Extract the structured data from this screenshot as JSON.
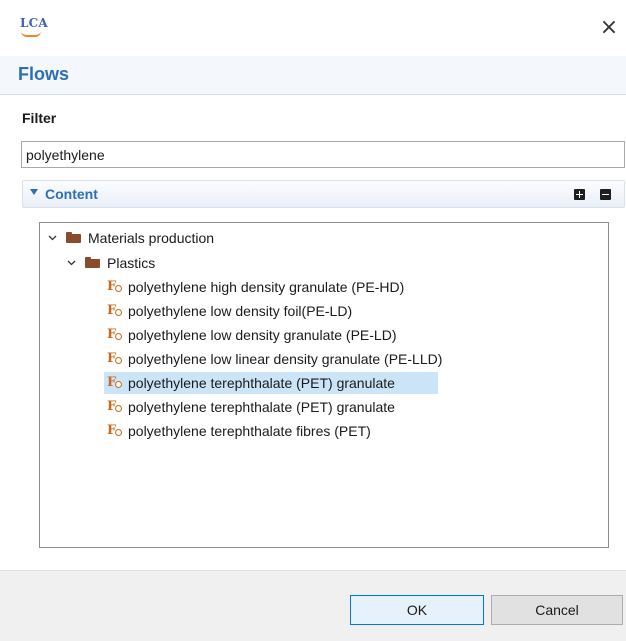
{
  "window": {
    "logo_text": "LCA",
    "close_glyph": "×"
  },
  "dialog": {
    "title": "Flows"
  },
  "filter": {
    "label": "Filter",
    "value": "polyethylene"
  },
  "section": {
    "title": "Content",
    "expand_icon": "plus-square-icon",
    "collapse_icon": "minus-square-icon"
  },
  "tree": {
    "root": {
      "label": "Materials production",
      "expanded": true
    },
    "category": {
      "label": "Plastics",
      "expanded": true
    },
    "flows": [
      {
        "label": "polyethylene high density granulate (PE-HD)",
        "selected": false
      },
      {
        "label": "polyethylene low density foil(PE-LD)",
        "selected": false
      },
      {
        "label": "polyethylene low density granulate (PE-LD)",
        "selected": false
      },
      {
        "label": "polyethylene low linear density granulate (PE-LLD)",
        "selected": false
      },
      {
        "label": "polyethylene terephthalate (PET) granulate",
        "selected": true
      },
      {
        "label": "polyethylene terephthalate (PET) granulate",
        "selected": false
      },
      {
        "label": "polyethylene terephthalate fibres (PET)",
        "selected": false
      }
    ],
    "flow_icon_glyph": "F"
  },
  "buttons": {
    "ok_label": "OK",
    "cancel_label": "Cancel"
  },
  "colors": {
    "accent": "#2c6fb3",
    "selection": "#cce4f7",
    "folder": "#8a4b2c",
    "flow_icon": "#c86b1e"
  }
}
